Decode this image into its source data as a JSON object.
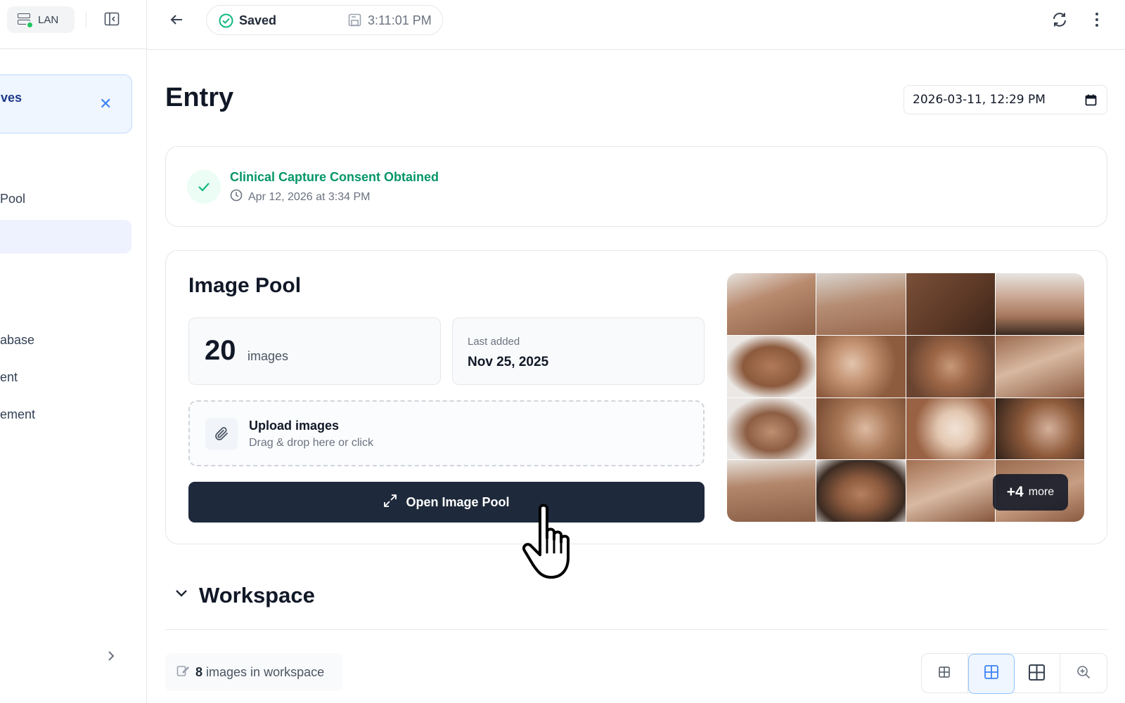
{
  "sidebar": {
    "network_label": "LAN",
    "notice_text": "ves",
    "items": [
      {
        "label": "Pool"
      },
      {
        "label": ""
      },
      {
        "label": "abase"
      },
      {
        "label": "ent"
      },
      {
        "label": "ement"
      }
    ]
  },
  "topbar": {
    "save_status": "Saved",
    "save_time": "3:11:01 PM"
  },
  "entry": {
    "title": "Entry",
    "datetime_value": "2026-03-11, 12:29 PM"
  },
  "consent": {
    "title": "Clinical Capture Consent Obtained",
    "timestamp": "Apr 12, 2026 at 3:34 PM"
  },
  "image_pool": {
    "title": "Image Pool",
    "count": "20",
    "count_unit": "images",
    "last_added_label": "Last added",
    "last_added_value": "Nov 25, 2025",
    "upload_title": "Upload images",
    "upload_hint": "Drag & drop here or click",
    "open_button": "Open Image Pool",
    "more_count": "+4",
    "more_label": "more"
  },
  "workspace": {
    "title": "Workspace",
    "count": "8",
    "count_label": "images in workspace"
  },
  "colors": {
    "accent_green": "#059669",
    "dark_button": "#1e293b",
    "active_view": "#3b82f6"
  }
}
